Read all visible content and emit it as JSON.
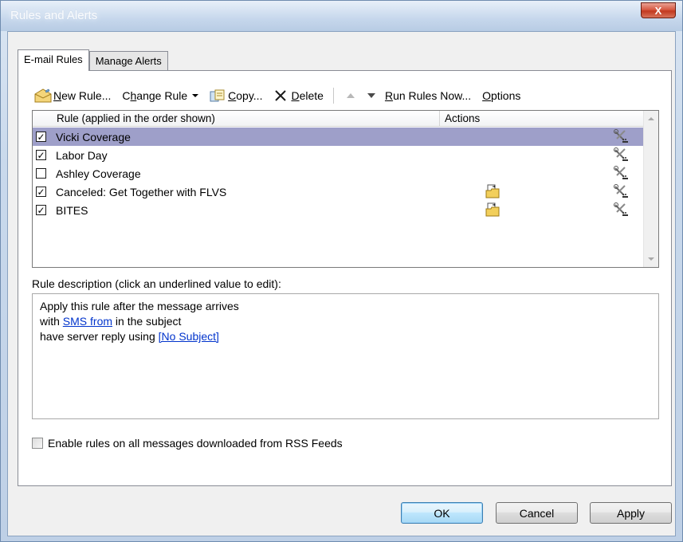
{
  "window": {
    "title": "Rules and Alerts",
    "close_glyph": "X"
  },
  "tabs": [
    {
      "label": "E-mail Rules",
      "active": true
    },
    {
      "label": "Manage Alerts",
      "active": false
    }
  ],
  "toolbar": {
    "new_rule": {
      "pre": "",
      "mn": "N",
      "post": "ew Rule..."
    },
    "change_rule": {
      "pre": "C",
      "mn": "h",
      "post": "ange Rule"
    },
    "copy": {
      "pre": "",
      "mn": "C",
      "post": "opy..."
    },
    "delete": {
      "pre": "",
      "mn": "D",
      "post": "elete"
    },
    "run_rules": {
      "pre": "",
      "mn": "R",
      "post": "un Rules Now..."
    },
    "options": {
      "pre": "",
      "mn": "O",
      "post": "ptions"
    }
  },
  "rule_list": {
    "columns": {
      "rule": "Rule (applied in the order shown)",
      "actions": "Actions"
    },
    "rows": [
      {
        "name": "Vicki Coverage",
        "checked": true,
        "selected": true,
        "has_action_icon": false
      },
      {
        "name": "Labor Day",
        "checked": true,
        "selected": false,
        "has_action_icon": false
      },
      {
        "name": "Ashley Coverage",
        "checked": false,
        "selected": false,
        "has_action_icon": false
      },
      {
        "name": "Canceled: Get Together with FLVS",
        "checked": true,
        "selected": false,
        "has_action_icon": true
      },
      {
        "name": "BITES",
        "checked": true,
        "selected": false,
        "has_action_icon": true
      }
    ],
    "check_glyph": "✓"
  },
  "description": {
    "label": "Rule description (click an underlined value to edit):",
    "line1": "Apply this rule after the message arrives",
    "line2_pre": "with ",
    "line2_link": "SMS from",
    "line2_post": " in the subject",
    "line3_pre": "have server reply using ",
    "line3_link": "[No Subject]"
  },
  "rss": {
    "label": "Enable rules on all messages downloaded from RSS Feeds",
    "checked": false
  },
  "buttons": {
    "ok": "OK",
    "cancel": "Cancel",
    "apply": "Apply"
  },
  "colors": {
    "selection": "#9e9fc9",
    "link": "#0033cc",
    "close": "#c2391f"
  }
}
